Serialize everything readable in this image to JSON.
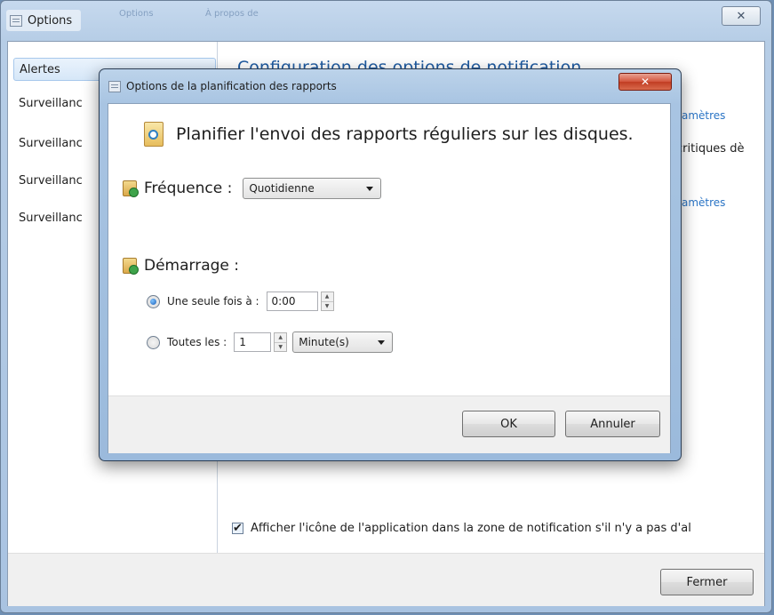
{
  "main_window": {
    "title": "Options",
    "faded_tabs": [
      "Options",
      "À propos de"
    ],
    "close_glyph": "✕"
  },
  "sidebar": {
    "items": [
      {
        "label": "Alertes",
        "selected": true
      },
      {
        "label": "Surveillanc"
      },
      {
        "label": "Surveillanc"
      },
      {
        "label": "Surveillanc"
      },
      {
        "label": "Surveillanc"
      }
    ]
  },
  "main": {
    "panel_title": "Configuration des options de notification",
    "link_1": "amètres",
    "text_critiques": "critiques dè",
    "link_2": "amètres",
    "checkbox_label": "Afficher l'icône de l'application dans la zone de notification s'il n'y a pas d'al",
    "checkbox_checked": true,
    "close_button": "Fermer"
  },
  "dialog": {
    "title": "Options de la planification des rapports",
    "close_glyph": "✕",
    "header": "Planifier l'envoi des rapports réguliers sur les disques.",
    "frequency_label": "Fréquence :",
    "frequency_value": "Quotidienne",
    "start_label": "Démarrage :",
    "once_label": "Une seule fois à :",
    "once_time": "0:00",
    "every_label": "Toutes les :",
    "every_value": "1",
    "every_unit": "Minute(s)",
    "selected_option": "once",
    "ok_button": "OK",
    "cancel_button": "Annuler"
  },
  "colors": {
    "title_accent": "#1e5aa0",
    "link": "#2a74c5",
    "close_red": "#c13d23"
  }
}
